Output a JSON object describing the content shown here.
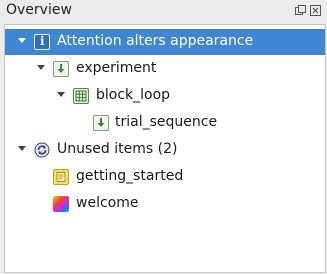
{
  "window": {
    "title": "Overview"
  },
  "tree": {
    "items": [
      {
        "label": "Attention alters appearance",
        "icon": "experiment-info-icon"
      },
      {
        "label": "experiment",
        "icon": "sequence-icon"
      },
      {
        "label": "block_loop",
        "icon": "loop-icon"
      },
      {
        "label": "trial_sequence",
        "icon": "sequence-icon"
      },
      {
        "label": "Unused items (2)",
        "icon": "unused-items-icon"
      },
      {
        "label": "getting_started",
        "icon": "notepad-icon"
      },
      {
        "label": "welcome",
        "icon": "sketchpad-icon"
      }
    ]
  },
  "colors": {
    "selection": "#3f86d3",
    "panel_background": "#ffffff",
    "chrome_background": "#ececec"
  }
}
